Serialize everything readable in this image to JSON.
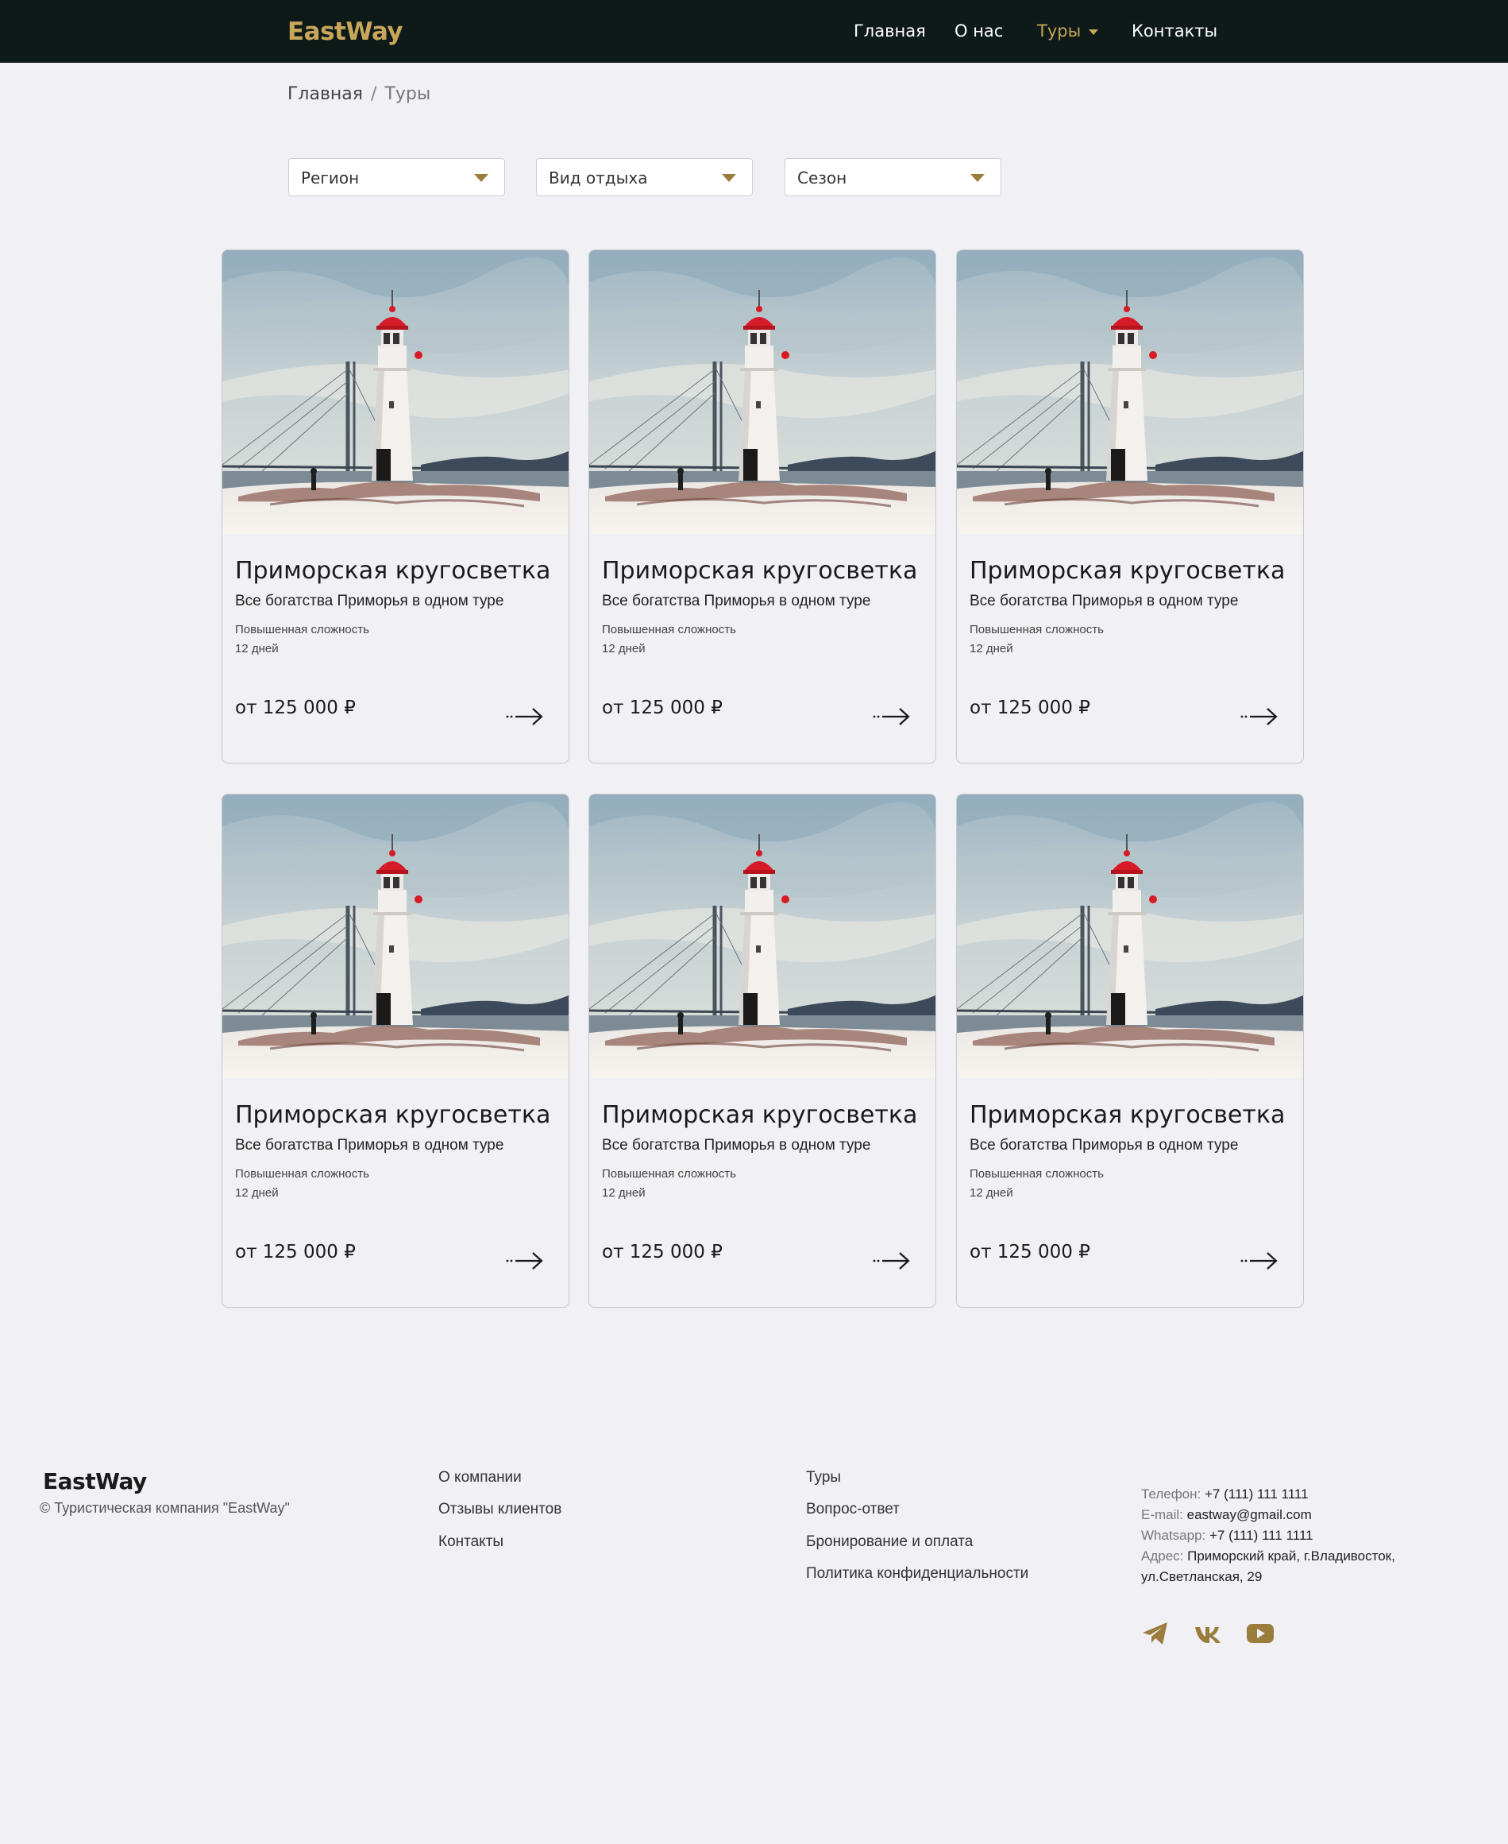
{
  "header": {
    "logo": "EastWay",
    "nav": [
      {
        "label": "Главная",
        "active": false
      },
      {
        "label": "О нас",
        "active": false
      },
      {
        "label": "Туры",
        "active": true
      },
      {
        "label": "Контакты",
        "active": false
      }
    ]
  },
  "breadcrumb": {
    "home": "Главная",
    "separator": "/",
    "current": "Туры"
  },
  "filters": [
    {
      "label": "Регион"
    },
    {
      "label": "Вид отдыха"
    },
    {
      "label": "Сезон"
    }
  ],
  "tours": [
    {
      "title": "Приморская кругосветка",
      "subtitle": "Все богатства Приморья в одном туре",
      "difficulty": "Повышенная сложность",
      "duration": "12 дней",
      "price": "от 125 000 ₽"
    },
    {
      "title": "Приморская кругосветка",
      "subtitle": "Все богатства Приморья в одном туре",
      "difficulty": "Повышенная сложность",
      "duration": "12 дней",
      "price": "от 125 000 ₽"
    },
    {
      "title": "Приморская кругосветка",
      "subtitle": "Все богатства Приморья в одном туре",
      "difficulty": "Повышенная сложность",
      "duration": "12 дней",
      "price": "от 125 000 ₽"
    },
    {
      "title": "Приморская кругосветка",
      "subtitle": "Все богатства Приморья в одном туре",
      "difficulty": "Повышенная сложность",
      "duration": "12 дней",
      "price": "от 125 000 ₽"
    },
    {
      "title": "Приморская кругосветка",
      "subtitle": "Все богатства Приморья в одном туре",
      "difficulty": "Повышенная сложность",
      "duration": "12 дней",
      "price": "от 125 000 ₽"
    },
    {
      "title": "Приморская кругосветка",
      "subtitle": "Все богатства Приморья в одном туре",
      "difficulty": "Повышенная сложность",
      "duration": "12 дней",
      "price": "от 125 000 ₽"
    }
  ],
  "footer": {
    "logo": "EastWay",
    "copyright": "© Туристическая компания \"EastWay\"",
    "col1": [
      "О компании",
      "Отзывы клиентов",
      "Контакты"
    ],
    "col2": [
      "Туры",
      "Вопрос-ответ",
      "Бронирование и оплата",
      "Политика конфиденциальности"
    ],
    "contacts": {
      "phone_label": "Телефон:",
      "phone": "+7 (111) 111 1111",
      "email_label": "E-mail:",
      "email": "eastway@gmail.com",
      "whatsapp_label": "Whatsapp:",
      "whatsapp": "+7 (111) 111 1111",
      "address_label": "Адрес:",
      "address_line1": "Приморский край, г.Владивосток,",
      "address_line2": "ул.Светланская, 29"
    },
    "social": [
      "telegram-icon",
      "vk-icon",
      "youtube-icon"
    ]
  },
  "colors": {
    "navbar_bg": "#0d1a17",
    "accent": "#c8a65a",
    "icon_gold": "#9a7d3c",
    "page_bg": "#f0f0f5"
  }
}
